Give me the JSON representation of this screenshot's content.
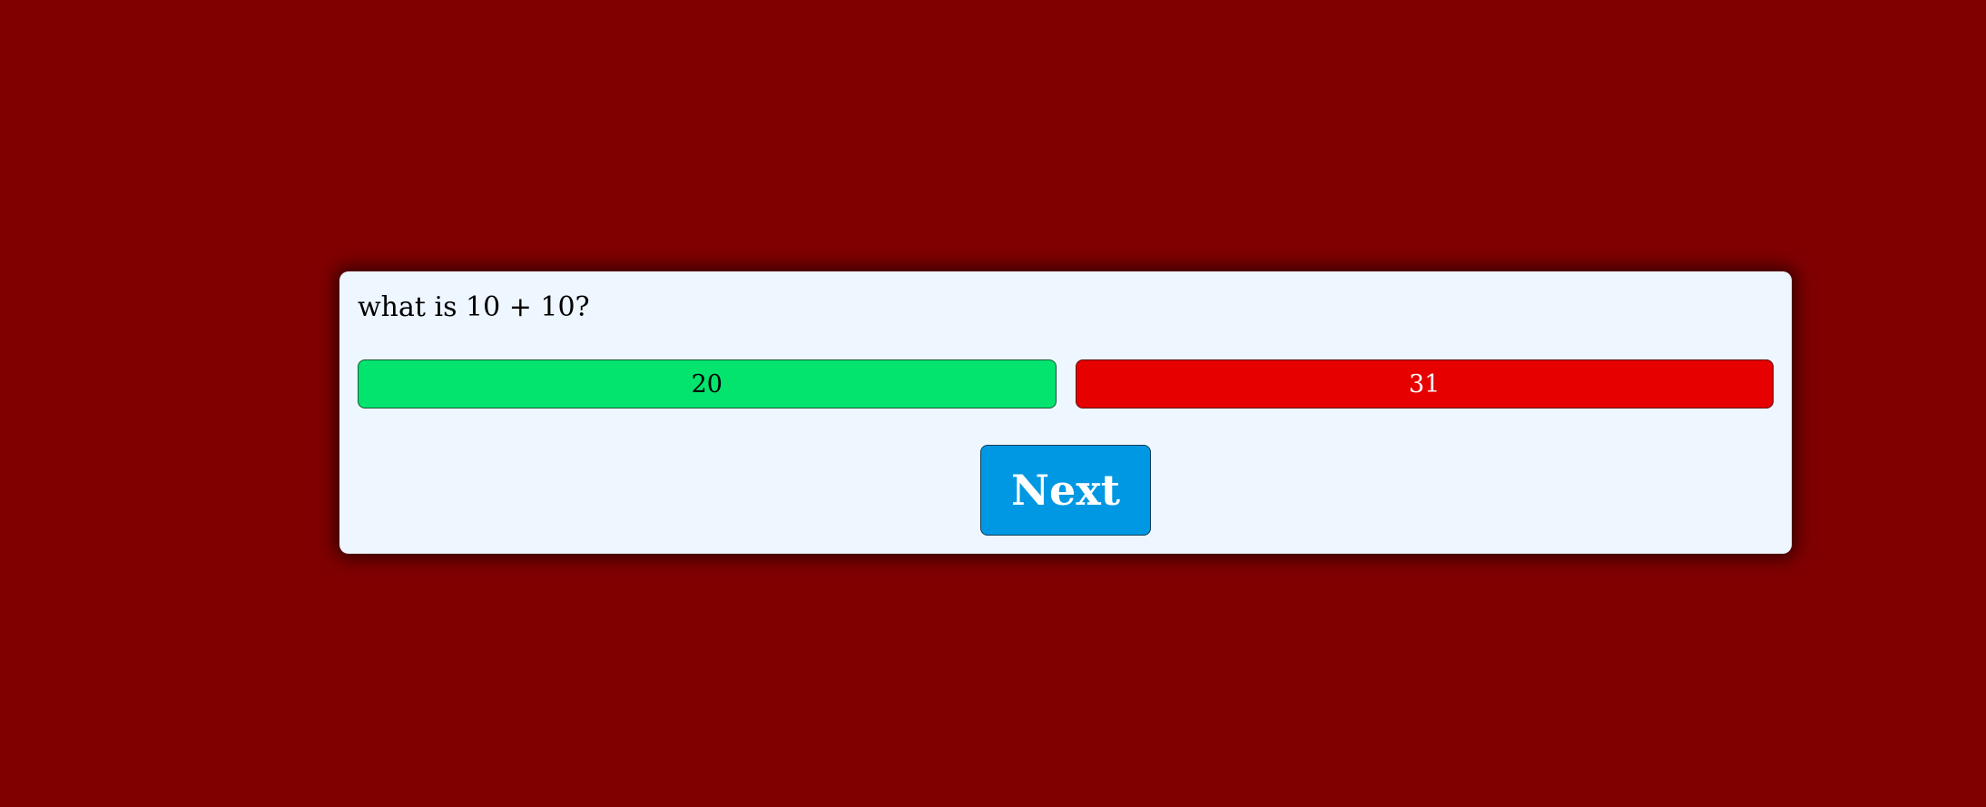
{
  "quiz": {
    "question": "what is 10 + 10?",
    "answers": [
      {
        "label": "20",
        "state": "correct",
        "color": "#02e46e"
      },
      {
        "label": "31",
        "state": "wrong",
        "color": "#e60000"
      }
    ],
    "next_label": "Next"
  },
  "colors": {
    "background": "#800000",
    "card": "#eef6ff",
    "next_button": "#0098e2"
  }
}
